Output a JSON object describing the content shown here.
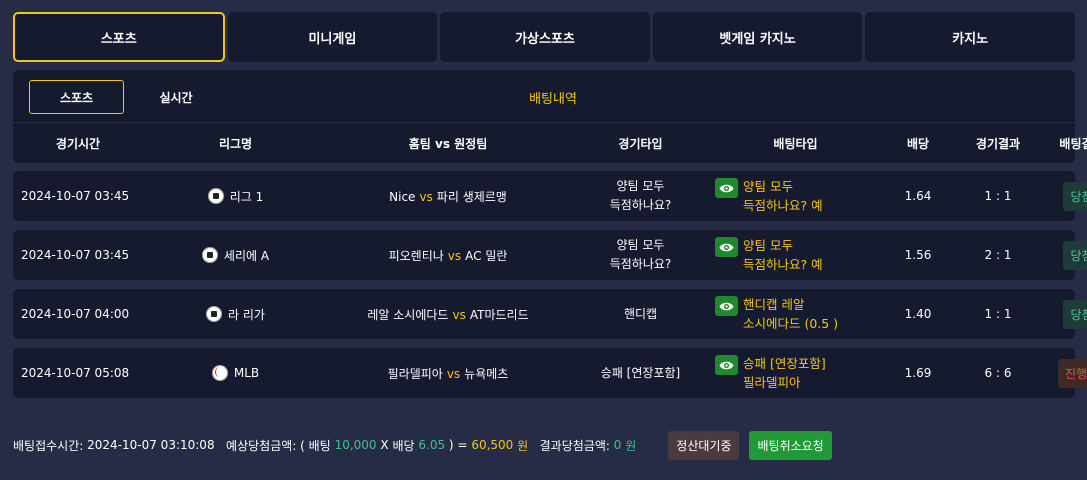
{
  "top_tabs": [
    {
      "label": "스포츠"
    },
    {
      "label": "미니게임"
    },
    {
      "label": "가상스포츠"
    },
    {
      "label": "벳게임 카지노"
    },
    {
      "label": "카지노"
    }
  ],
  "sub_tabs": {
    "sports": "스포츠",
    "live": "실시간",
    "bet_history": "배팅내역"
  },
  "columns": [
    "경기시간",
    "리그명",
    "홈팀 vs 원정팀",
    "경기타입",
    "배팅타입",
    "배당",
    "경기결과",
    "배팅결과"
  ],
  "vs_label": "vs",
  "rows": [
    {
      "time": "2024-10-07 03:45",
      "league": "리그 1",
      "league_icon": "soccer-ball-icon",
      "home": "Nice",
      "away": "파리 생제르맹",
      "game_type_1": "양팀 모두",
      "game_type_2": "득점하나요?",
      "bet_type_1": "양팀 모두",
      "bet_type_2": "득점하나요? 예",
      "odds": "1.64",
      "score": "1 : 1",
      "status": "당첨"
    },
    {
      "time": "2024-10-07 03:45",
      "league": "세리에 A",
      "league_icon": "soccer-ball-icon",
      "home": "피오렌티나",
      "away": "AC 밀란",
      "game_type_1": "양팀 모두",
      "game_type_2": "득점하나요?",
      "bet_type_1": "양팀 모두",
      "bet_type_2": "득점하나요? 예",
      "odds": "1.56",
      "score": "2 : 1",
      "status": "당첨"
    },
    {
      "time": "2024-10-07 04:00",
      "league": "라 리가",
      "league_icon": "soccer-ball-icon",
      "home": "레알 소시에다드",
      "away": "AT마드리드",
      "game_type_1": "핸디캡",
      "game_type_2": "",
      "bet_type_1": "핸디캡 레알",
      "bet_type_2": "소시에다드 (0.5 )",
      "odds": "1.40",
      "score": "1 : 1",
      "status": "당첨"
    },
    {
      "time": "2024-10-07 05:08",
      "league": "MLB",
      "league_icon": "baseball-icon",
      "home": "필라델피아",
      "away": "뉴욕메츠",
      "game_type_1": "승패 [연장포함]",
      "game_type_2": "",
      "bet_type_1": "승패 [연장포함]",
      "bet_type_2": "필라델피아",
      "odds": "1.69",
      "score": "6 : 6",
      "status": "진행중"
    }
  ],
  "footer": {
    "accept_time_label": "배팅접수시간:",
    "accept_time": "2024-10-07 03:10:08",
    "expected_label": "예상당첨금액: (",
    "bet_label": "배팅",
    "bet_amount": "10,000",
    "times": "X",
    "odds_label": "배당",
    "total_odds": "6.05",
    "close_eq": ") =",
    "expected_amount": "60,500",
    "won": "원",
    "result_label": "결과당첨금액:",
    "result_amount": "0",
    "won2": "원",
    "settle_button": "정산대기중",
    "cancel_button": "배팅취소요청"
  },
  "colors": {
    "accent": "#f5c518",
    "win": "#4fc3a1",
    "progress": "#e0553f",
    "panel": "#151a2e",
    "background": "#262c46"
  }
}
